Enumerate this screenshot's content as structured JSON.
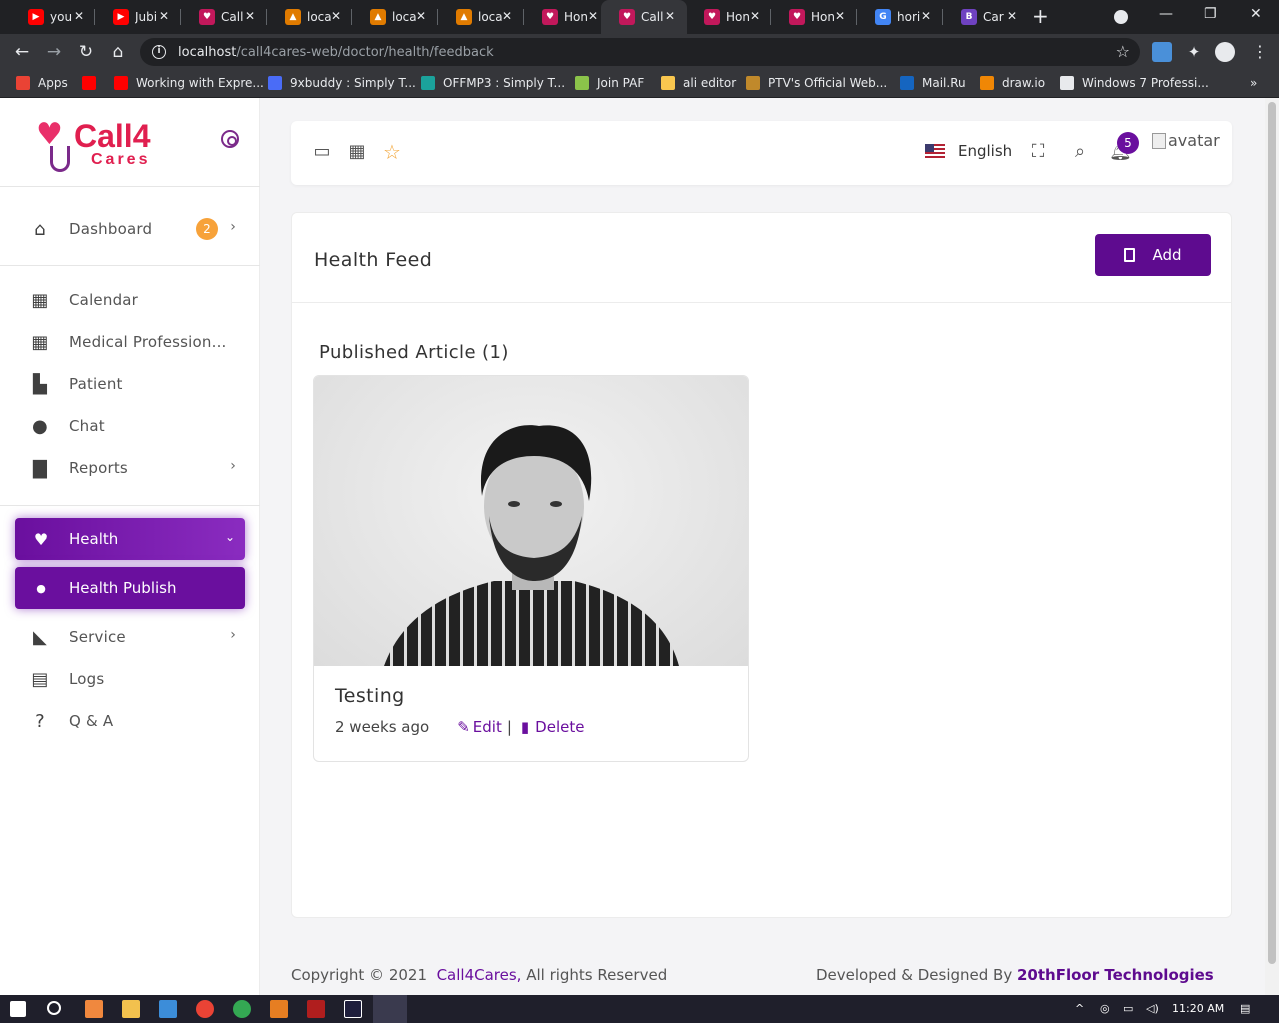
{
  "browser": {
    "tabs": [
      {
        "title": "you",
        "color": "#ff0000",
        "glyph": "▶"
      },
      {
        "title": "Jubi",
        "color": "#ff0000",
        "glyph": "▶"
      },
      {
        "title": "Call",
        "color": "#c2185b",
        "glyph": "♥"
      },
      {
        "title": "loca",
        "color": "#e07b00",
        "glyph": "▲"
      },
      {
        "title": "loca",
        "color": "#e07b00",
        "glyph": "▲"
      },
      {
        "title": "loca",
        "color": "#e07b00",
        "glyph": "▲"
      },
      {
        "title": "Hon",
        "color": "#c2185b",
        "glyph": "♥"
      },
      {
        "title": "Call",
        "color": "#c2185b",
        "glyph": "♥",
        "active": true
      },
      {
        "title": "Hon",
        "color": "#c2185b",
        "glyph": "♥"
      },
      {
        "title": "Hon",
        "color": "#c2185b",
        "glyph": "♥"
      },
      {
        "title": "hori",
        "color": "#4285f4",
        "glyph": "G"
      },
      {
        "title": "Car",
        "color": "#6f42c1",
        "glyph": "B"
      }
    ],
    "url_host": "localhost",
    "url_path": "/call4cares-web/doctor/health/feedback",
    "bookmarks": [
      {
        "label": "Apps",
        "color": "#ea4335"
      },
      {
        "label": "",
        "color": "#ff0000"
      },
      {
        "label": "Working with Expre...",
        "color": "#ff0000"
      },
      {
        "label": "9xbuddy : Simply T...",
        "color": "#4a6cf7"
      },
      {
        "label": "OFFMP3 : Simply T...",
        "color": "#1ba29b"
      },
      {
        "label": "Join PAF",
        "color": "#8bc34a"
      },
      {
        "label": "ali editor",
        "color": "#f9c74f"
      },
      {
        "label": "PTV's Official Web...",
        "color": "#c0892b"
      },
      {
        "label": "Mail.Ru",
        "color": "#1565c0"
      },
      {
        "label": "draw.io",
        "color": "#f08705"
      },
      {
        "label": "Windows 7 Professi...",
        "color": "#e8eaed"
      }
    ]
  },
  "brand": {
    "logo_line1": "Call4",
    "logo_line2": "Cares"
  },
  "sidebar": {
    "dashboard": {
      "label": "Dashboard",
      "badge": "2"
    },
    "items": [
      {
        "label": "Calendar",
        "icon": "calendar-plus-icon"
      },
      {
        "label": "Medical Profession...",
        "icon": "calendar-plus-icon"
      },
      {
        "label": "Patient",
        "icon": "hospital-user-icon"
      },
      {
        "label": "Chat",
        "icon": "comment-dots-icon"
      },
      {
        "label": "Reports",
        "icon": "file-icon"
      }
    ],
    "health": {
      "label": "Health"
    },
    "health_publish": {
      "label": "Health Publish"
    },
    "lower": [
      {
        "label": "Service",
        "icon": "satellite-dish-icon"
      },
      {
        "label": "Logs",
        "icon": "clipboard-list-icon"
      },
      {
        "label": "Q & A",
        "icon": "question-circle-icon"
      }
    ]
  },
  "header": {
    "language": "English",
    "notification_count": "5",
    "avatar_alt": "avatar"
  },
  "main": {
    "title": "Health Feed",
    "add_label": "Add",
    "published_heading": "Published Article (1)",
    "articles": [
      {
        "title": "Testing",
        "time": "2 weeks ago",
        "edit_label": "Edit",
        "delete_label": "Delete"
      }
    ]
  },
  "footer": {
    "copyright_prefix": "Copyright © 2021",
    "company": "Call4Cares,",
    "rights": "All rights Reserved",
    "developed_prefix": "Developed & Designed By",
    "developer": "20thFloor Technologies"
  },
  "taskbar": {
    "time": "11:20 AM"
  },
  "colors": {
    "accent": "#5e0b8f",
    "brand_red": "#e01f4f",
    "badge_orange": "#f7a23a"
  }
}
